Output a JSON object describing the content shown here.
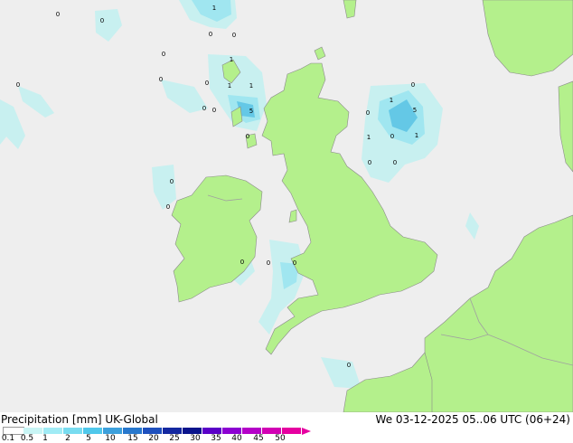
{
  "map": {
    "background_color": "#eeeeee",
    "land_color": "#b4f08c",
    "border_color": "#a0a0a0",
    "precip_colors": [
      "#c8f0f0",
      "#a0e6f0",
      "#64c8e6"
    ],
    "point_labels": [
      "0",
      "0",
      "1",
      "0",
      "0",
      "0",
      "0",
      "1",
      "0",
      "1",
      "1",
      "0",
      "0",
      "5",
      "0",
      "0",
      "0",
      "1",
      "5",
      "0",
      "1",
      "0",
      "1",
      "0",
      "0",
      "0",
      "0",
      "0",
      "0",
      "0",
      "0"
    ]
  },
  "footer": {
    "title": "Precipitation [mm]  UK-Global",
    "datetime": "We 03-12-2025 05..06 UTC (06+24)"
  },
  "legend": {
    "colors": [
      "#ffffff",
      "#c8f5f5",
      "#a0ebf5",
      "#78dcf0",
      "#50c8eb",
      "#3ca0dc",
      "#2878cd",
      "#1e50be",
      "#1428a0",
      "#0a148c",
      "#5a00c8",
      "#8c00d2",
      "#b400c8",
      "#d200b4",
      "#e600a0"
    ],
    "labels": [
      "0.1",
      "0.5",
      "1",
      "2",
      "5",
      "10",
      "15",
      "20",
      "25",
      "30",
      "35",
      "40",
      "45",
      "50"
    ],
    "arrow_color": "#e600a0"
  }
}
